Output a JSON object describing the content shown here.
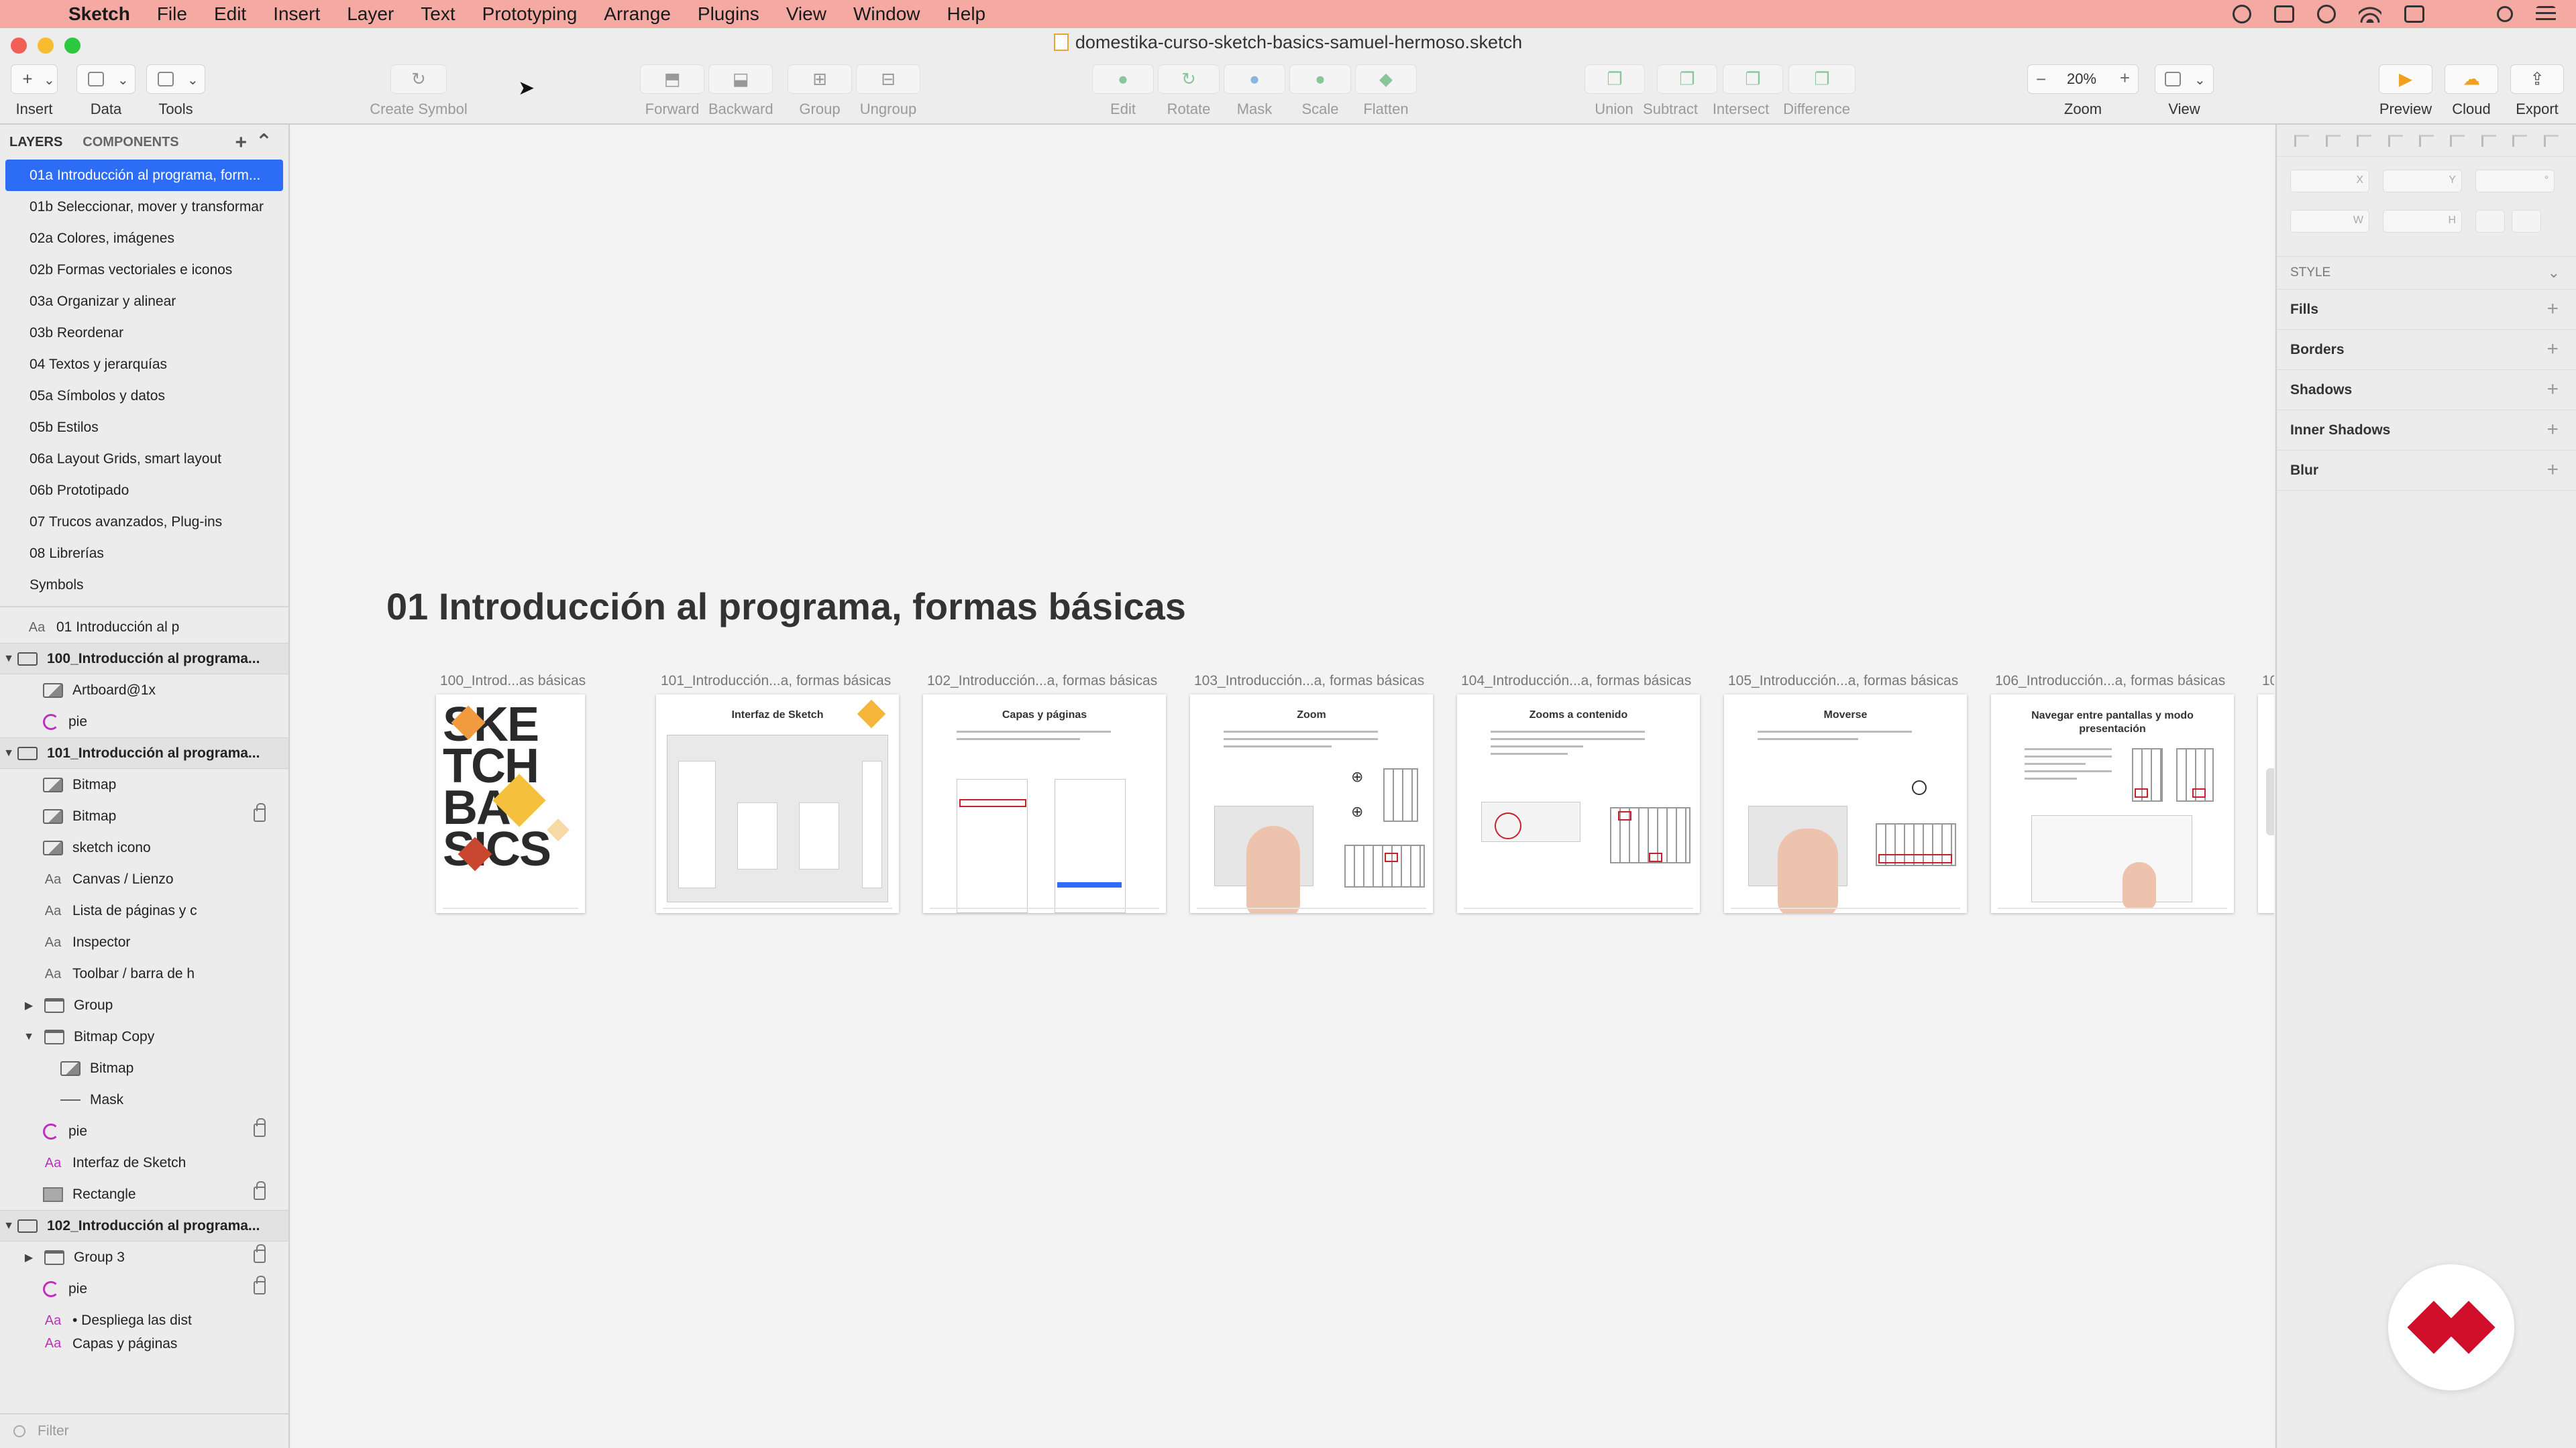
{
  "menubar": {
    "apple": "",
    "items": [
      "Sketch",
      "File",
      "Edit",
      "Insert",
      "Layer",
      "Text",
      "Prototyping",
      "Arrange",
      "Plugins",
      "View",
      "Window",
      "Help"
    ]
  },
  "window": {
    "title": "domestika-curso-sketch-basics-samuel-hermoso.sketch"
  },
  "toolbar": {
    "insert": "Insert",
    "data": "Data",
    "tools": "Tools",
    "create_symbol": "Create Symbol",
    "forward": "Forward",
    "backward": "Backward",
    "group": "Group",
    "ungroup": "Ungroup",
    "edit": "Edit",
    "rotate": "Rotate",
    "mask": "Mask",
    "scale": "Scale",
    "flatten": "Flatten",
    "union": "Union",
    "subtract": "Subtract",
    "intersect": "Intersect",
    "difference": "Difference",
    "zoom_value": "20%",
    "zoom": "Zoom",
    "view": "View",
    "preview": "Preview",
    "cloud": "Cloud",
    "export": "Export"
  },
  "left_panel": {
    "tabs": {
      "layers": "LAYERS",
      "components": "COMPONENTS"
    },
    "pages": [
      "01a Introducción al programa, form...",
      "01b Seleccionar, mover y transformar",
      "02a Colores, imágenes",
      "02b Formas vectoriales e iconos",
      "03a Organizar y alinear",
      "03b Reordenar",
      "04 Textos y jerarquías",
      "05a Símbolos y datos",
      "05b Estilos",
      "06a Layout Grids, smart layout",
      "06b Prototipado",
      "07 Trucos avanzados, Plug-ins",
      "08 Librerías",
      "Symbols"
    ],
    "layers": {
      "text_top": "01 Introducción al p",
      "artboard_100": "100_Introducción al programa...",
      "artboard_100_items": [
        "Artboard@1x",
        "pie"
      ],
      "artboard_101": "101_Introducción al programa...",
      "artboard_101_items": [
        "Bitmap",
        "Bitmap",
        "sketch icono",
        "Canvas / Lienzo",
        "Lista de páginas y c",
        "Inspector",
        "Toolbar / barra de h",
        "Group",
        "Bitmap Copy",
        "Bitmap",
        "Mask",
        "pie",
        "Interfaz de Sketch",
        "Rectangle"
      ],
      "artboard_102": "102_Introducción al programa...",
      "artboard_102_items": [
        "Group 3",
        "pie",
        "• Despliega las dist",
        "Capas y páginas"
      ]
    },
    "filter_placeholder": "Filter"
  },
  "canvas": {
    "page_heading": "01 Introducción al programa, formas básicas",
    "artboards": [
      {
        "label": "100_Introd...as básicas",
        "poster": "SKE\nTCH\nBA\nSICS"
      },
      {
        "label": "101_Introducción...a, formas básicas",
        "title": "Interfaz de Sketch"
      },
      {
        "label": "102_Introducción...a, formas básicas",
        "title": "Capas y páginas"
      },
      {
        "label": "103_Introducción...a, formas básicas",
        "title": "Zoom"
      },
      {
        "label": "104_Introducción...a, formas básicas",
        "title": "Zooms a contenido"
      },
      {
        "label": "105_Introducción...a, formas básicas",
        "title": "Moverse"
      },
      {
        "label": "106_Introducción...a, formas básicas",
        "title": "Navegar entre pantallas y modo presentación"
      },
      {
        "label": "10"
      }
    ]
  },
  "inspector": {
    "x": "X",
    "y": "Y",
    "w": "W",
    "h": "H",
    "style": "STYLE",
    "sections": [
      "Fills",
      "Borders",
      "Shadows",
      "Inner Shadows",
      "Blur"
    ]
  },
  "colors": {
    "menubar": "#f4a9a3",
    "selection": "#2d6df6",
    "brand": "#d0102b"
  }
}
